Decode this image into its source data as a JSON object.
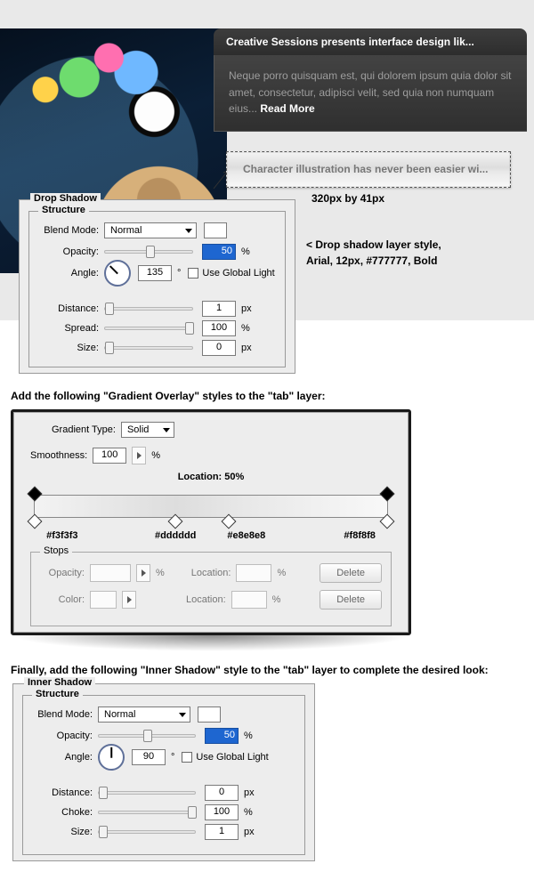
{
  "headline": {
    "title": "Creative Sessions presents interface design lik...",
    "body": "Neque porro quisquam est, qui dolorem ipsum quia dolor sit amet, consectetur, adipisci velit, sed quia non numquam eius... ",
    "read_more": "Read More"
  },
  "sub_tab": {
    "text": "Character illustration has never been easier wi...",
    "size_note": "320px by 41px"
  },
  "side_notes": {
    "line1": "< Drop shadow layer style,",
    "line2": "Arial, 12px, #777777, Bold"
  },
  "panels": {
    "drop_shadow": {
      "outer_title": "Drop Shadow",
      "inner_title": "Structure",
      "blend_mode_label": "Blend Mode:",
      "blend_mode_value": "Normal",
      "opacity_label": "Opacity:",
      "opacity_value": "50",
      "angle_label": "Angle:",
      "angle_value": "135",
      "angle_deg": "°",
      "use_global": "Use Global Light",
      "distance_label": "Distance:",
      "distance_value": "1",
      "spread_label": "Spread:",
      "spread_value": "100",
      "size_label": "Size:",
      "size_value": "0",
      "pct": "%",
      "px": "px"
    },
    "gradient": {
      "caption": "Add the following \"Gradient Overlay\" styles to the \"tab\" layer:",
      "type_label": "Gradient Type:",
      "type_value": "Solid",
      "smooth_label": "Smoothness:",
      "smooth_value": "100",
      "location_label": "Location: 50%",
      "color_stops": [
        "#f3f3f3",
        "#dddddd",
        "#e8e8e8",
        "#f8f8f8"
      ],
      "stops_title": "Stops",
      "opacity_label": "Opacity:",
      "location_label2": "Location:",
      "color_label": "Color:",
      "delete_label": "Delete",
      "pct": "%"
    },
    "inner_shadow": {
      "caption": "Finally, add the following \"Inner Shadow\" style to the \"tab\" layer to complete the desired look:",
      "outer_title": "Inner Shadow",
      "inner_title": "Structure",
      "blend_mode_label": "Blend Mode:",
      "blend_mode_value": "Normal",
      "opacity_label": "Opacity:",
      "opacity_value": "50",
      "angle_label": "Angle:",
      "angle_value": "90",
      "angle_deg": "°",
      "use_global": "Use Global Light",
      "distance_label": "Distance:",
      "distance_value": "0",
      "choke_label": "Choke:",
      "choke_value": "100",
      "size_label": "Size:",
      "size_value": "1",
      "pct": "%",
      "px": "px"
    }
  }
}
